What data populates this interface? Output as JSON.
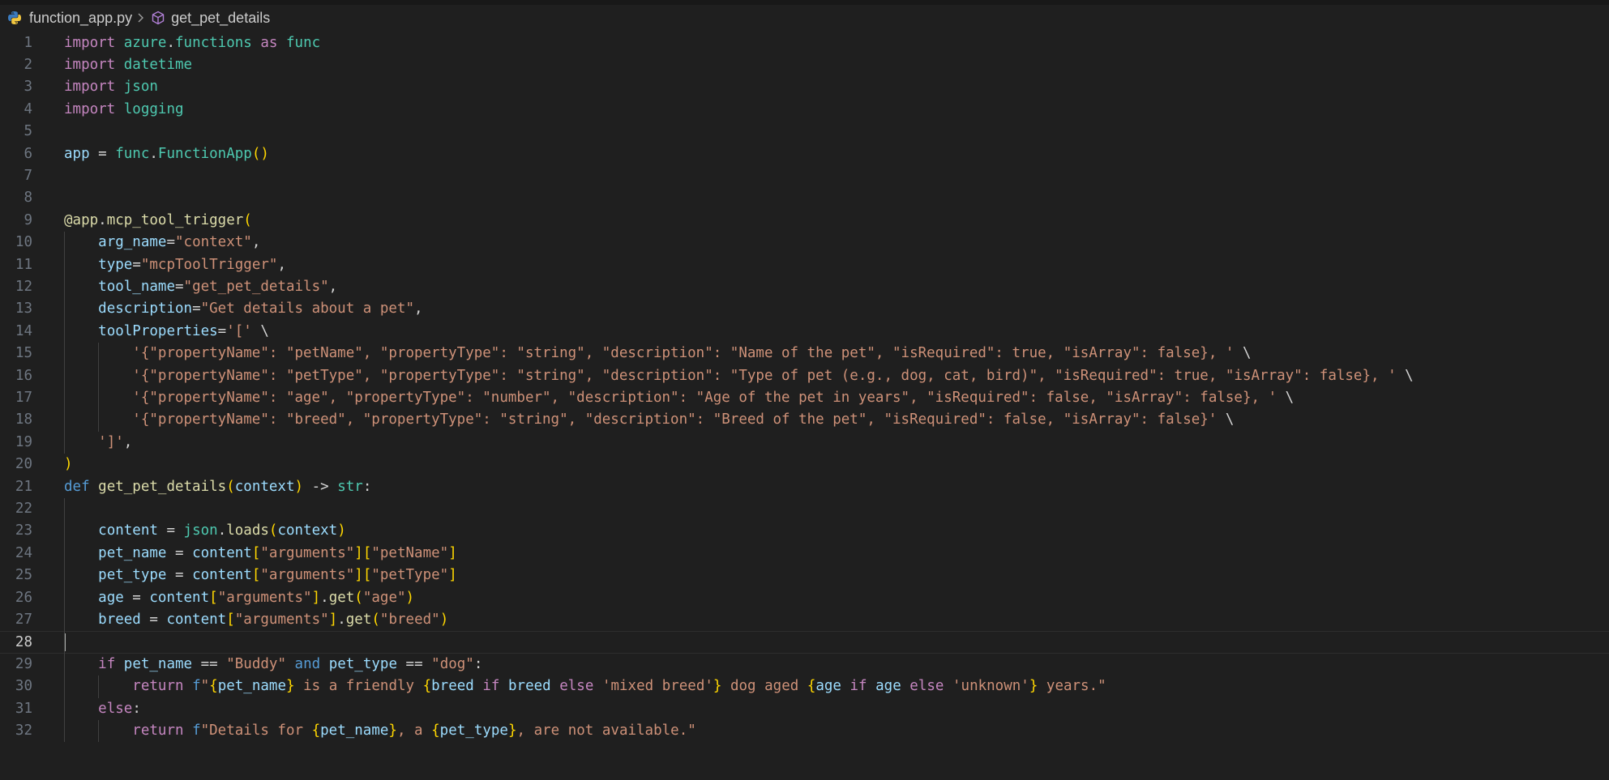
{
  "breadcrumb": {
    "file": "function_app.py",
    "symbol": "get_pet_details",
    "file_icon": "python-icon",
    "symbol_icon": "method-cube-icon"
  },
  "editor": {
    "language": "python",
    "active_line": 28,
    "colors": {
      "background": "#1f1f1f",
      "keyword": "#c586c0",
      "storage": "#569cd6",
      "module": "#4ec9b0",
      "function": "#dcdcaa",
      "variable": "#9cdcfe",
      "string": "#ce9178",
      "bracket": "#ffd700",
      "bracket2": "#da70d6",
      "operator": "#d4d4d4",
      "line_number": "#6e7681"
    },
    "lines": [
      {
        "n": "1",
        "tokens": [
          {
            "t": "import",
            "c": "k"
          },
          {
            "t": " ",
            "c": "p"
          },
          {
            "t": "azure",
            "c": "m"
          },
          {
            "t": ".",
            "c": "p"
          },
          {
            "t": "functions",
            "c": "m"
          },
          {
            "t": " ",
            "c": "p"
          },
          {
            "t": "as",
            "c": "k"
          },
          {
            "t": " ",
            "c": "p"
          },
          {
            "t": "func",
            "c": "m"
          }
        ]
      },
      {
        "n": "2",
        "tokens": [
          {
            "t": "import",
            "c": "k"
          },
          {
            "t": " ",
            "c": "p"
          },
          {
            "t": "datetime",
            "c": "md"
          }
        ]
      },
      {
        "n": "3",
        "tokens": [
          {
            "t": "import",
            "c": "k"
          },
          {
            "t": " ",
            "c": "p"
          },
          {
            "t": "json",
            "c": "m"
          }
        ]
      },
      {
        "n": "4",
        "tokens": [
          {
            "t": "import",
            "c": "k"
          },
          {
            "t": " ",
            "c": "p"
          },
          {
            "t": "logging",
            "c": "md"
          }
        ]
      },
      {
        "n": "5",
        "tokens": []
      },
      {
        "n": "6",
        "tokens": [
          {
            "t": "app",
            "c": "v"
          },
          {
            "t": " = ",
            "c": "p"
          },
          {
            "t": "func",
            "c": "m"
          },
          {
            "t": ".",
            "c": "p"
          },
          {
            "t": "FunctionApp",
            "c": "m"
          },
          {
            "t": "()",
            "c": "b1"
          }
        ]
      },
      {
        "n": "7",
        "tokens": []
      },
      {
        "n": "8",
        "tokens": []
      },
      {
        "n": "9",
        "tokens": [
          {
            "t": "@app",
            "c": "f"
          },
          {
            "t": ".",
            "c": "p"
          },
          {
            "t": "mcp_tool_trigger",
            "c": "f"
          },
          {
            "t": "(",
            "c": "b1"
          }
        ]
      },
      {
        "n": "10",
        "tokens": [
          {
            "t": "    ",
            "c": "p"
          },
          {
            "t": "arg_name",
            "c": "v"
          },
          {
            "t": "=",
            "c": "p"
          },
          {
            "t": "\"context\"",
            "c": "s"
          },
          {
            "t": ",",
            "c": "p"
          }
        ]
      },
      {
        "n": "11",
        "tokens": [
          {
            "t": "    ",
            "c": "p"
          },
          {
            "t": "type",
            "c": "v"
          },
          {
            "t": "=",
            "c": "p"
          },
          {
            "t": "\"mcpToolTrigger\"",
            "c": "s"
          },
          {
            "t": ",",
            "c": "p"
          }
        ]
      },
      {
        "n": "12",
        "tokens": [
          {
            "t": "    ",
            "c": "p"
          },
          {
            "t": "tool_name",
            "c": "v"
          },
          {
            "t": "=",
            "c": "p"
          },
          {
            "t": "\"get_pet_details\"",
            "c": "s"
          },
          {
            "t": ",",
            "c": "p"
          }
        ]
      },
      {
        "n": "13",
        "tokens": [
          {
            "t": "    ",
            "c": "p"
          },
          {
            "t": "description",
            "c": "v"
          },
          {
            "t": "=",
            "c": "p"
          },
          {
            "t": "\"Get details about a pet\"",
            "c": "s"
          },
          {
            "t": ",",
            "c": "p"
          }
        ]
      },
      {
        "n": "14",
        "tokens": [
          {
            "t": "    ",
            "c": "p"
          },
          {
            "t": "toolProperties",
            "c": "v"
          },
          {
            "t": "=",
            "c": "p"
          },
          {
            "t": "'['",
            "c": "s"
          },
          {
            "t": " \\",
            "c": "p"
          }
        ]
      },
      {
        "n": "15",
        "tokens": [
          {
            "t": "        ",
            "c": "p"
          },
          {
            "t": "'{\"propertyName\": \"petName\", \"propertyType\": \"string\", \"description\": \"Name of the pet\", \"isRequired\": true, \"isArray\": false}, '",
            "c": "s"
          },
          {
            "t": " \\",
            "c": "p"
          }
        ]
      },
      {
        "n": "16",
        "tokens": [
          {
            "t": "        ",
            "c": "p"
          },
          {
            "t": "'{\"propertyName\": \"petType\", \"propertyType\": \"string\", \"description\": \"Type of pet (e.g., dog, cat, bird)\", \"isRequired\": true, \"isArray\": false}, '",
            "c": "s"
          },
          {
            "t": " \\",
            "c": "p"
          }
        ]
      },
      {
        "n": "17",
        "tokens": [
          {
            "t": "        ",
            "c": "p"
          },
          {
            "t": "'{\"propertyName\": \"age\", \"propertyType\": \"number\", \"description\": \"Age of the pet in years\", \"isRequired\": false, \"isArray\": false}, '",
            "c": "s"
          },
          {
            "t": " \\",
            "c": "p"
          }
        ]
      },
      {
        "n": "18",
        "tokens": [
          {
            "t": "        ",
            "c": "p"
          },
          {
            "t": "'{\"propertyName\": \"breed\", \"propertyType\": \"string\", \"description\": \"Breed of the pet\", \"isRequired\": false, \"isArray\": false}'",
            "c": "s"
          },
          {
            "t": " \\",
            "c": "p"
          }
        ]
      },
      {
        "n": "19",
        "tokens": [
          {
            "t": "    ",
            "c": "p"
          },
          {
            "t": "']'",
            "c": "s"
          },
          {
            "t": ",",
            "c": "p"
          }
        ]
      },
      {
        "n": "20",
        "tokens": [
          {
            "t": ")",
            "c": "b1"
          }
        ]
      },
      {
        "n": "21",
        "tokens": [
          {
            "t": "def",
            "c": "st"
          },
          {
            "t": " ",
            "c": "p"
          },
          {
            "t": "get_pet_details",
            "c": "f"
          },
          {
            "t": "(",
            "c": "b1"
          },
          {
            "t": "context",
            "c": "v"
          },
          {
            "t": ")",
            "c": "b1"
          },
          {
            "t": " -> ",
            "c": "p"
          },
          {
            "t": "str",
            "c": "m"
          },
          {
            "t": ":",
            "c": "p"
          }
        ]
      },
      {
        "n": "22",
        "tokens": []
      },
      {
        "n": "23",
        "tokens": [
          {
            "t": "    ",
            "c": "p"
          },
          {
            "t": "content",
            "c": "v"
          },
          {
            "t": " = ",
            "c": "p"
          },
          {
            "t": "json",
            "c": "m"
          },
          {
            "t": ".",
            "c": "p"
          },
          {
            "t": "loads",
            "c": "f"
          },
          {
            "t": "(",
            "c": "b1"
          },
          {
            "t": "context",
            "c": "v"
          },
          {
            "t": ")",
            "c": "b1"
          }
        ]
      },
      {
        "n": "24",
        "tokens": [
          {
            "t": "    ",
            "c": "p"
          },
          {
            "t": "pet_name",
            "c": "v"
          },
          {
            "t": " = ",
            "c": "p"
          },
          {
            "t": "content",
            "c": "v"
          },
          {
            "t": "[",
            "c": "b1"
          },
          {
            "t": "\"arguments\"",
            "c": "s"
          },
          {
            "t": "][",
            "c": "b1"
          },
          {
            "t": "\"petName\"",
            "c": "s"
          },
          {
            "t": "]",
            "c": "b1"
          }
        ]
      },
      {
        "n": "25",
        "tokens": [
          {
            "t": "    ",
            "c": "p"
          },
          {
            "t": "pet_type",
            "c": "v"
          },
          {
            "t": " = ",
            "c": "p"
          },
          {
            "t": "content",
            "c": "v"
          },
          {
            "t": "[",
            "c": "b1"
          },
          {
            "t": "\"arguments\"",
            "c": "s"
          },
          {
            "t": "][",
            "c": "b1"
          },
          {
            "t": "\"petType\"",
            "c": "s"
          },
          {
            "t": "]",
            "c": "b1"
          }
        ]
      },
      {
        "n": "26",
        "tokens": [
          {
            "t": "    ",
            "c": "p"
          },
          {
            "t": "age",
            "c": "v"
          },
          {
            "t": " = ",
            "c": "p"
          },
          {
            "t": "content",
            "c": "v"
          },
          {
            "t": "[",
            "c": "b1"
          },
          {
            "t": "\"arguments\"",
            "c": "s"
          },
          {
            "t": "]",
            "c": "b1"
          },
          {
            "t": ".",
            "c": "p"
          },
          {
            "t": "get",
            "c": "f"
          },
          {
            "t": "(",
            "c": "b1"
          },
          {
            "t": "\"age\"",
            "c": "s"
          },
          {
            "t": ")",
            "c": "b1"
          }
        ]
      },
      {
        "n": "27",
        "tokens": [
          {
            "t": "    ",
            "c": "p"
          },
          {
            "t": "breed",
            "c": "v"
          },
          {
            "t": " = ",
            "c": "p"
          },
          {
            "t": "content",
            "c": "v"
          },
          {
            "t": "[",
            "c": "b1"
          },
          {
            "t": "\"arguments\"",
            "c": "s"
          },
          {
            "t": "]",
            "c": "b1"
          },
          {
            "t": ".",
            "c": "p"
          },
          {
            "t": "get",
            "c": "f"
          },
          {
            "t": "(",
            "c": "b1"
          },
          {
            "t": "\"breed\"",
            "c": "s"
          },
          {
            "t": ")",
            "c": "b1"
          }
        ]
      },
      {
        "n": "28",
        "tokens": []
      },
      {
        "n": "29",
        "tokens": [
          {
            "t": "    ",
            "c": "p"
          },
          {
            "t": "if",
            "c": "k"
          },
          {
            "t": " ",
            "c": "p"
          },
          {
            "t": "pet_name",
            "c": "v"
          },
          {
            "t": " == ",
            "c": "p"
          },
          {
            "t": "\"Buddy\"",
            "c": "s"
          },
          {
            "t": " ",
            "c": "p"
          },
          {
            "t": "and",
            "c": "st"
          },
          {
            "t": " ",
            "c": "p"
          },
          {
            "t": "pet_type",
            "c": "v"
          },
          {
            "t": " == ",
            "c": "p"
          },
          {
            "t": "\"dog\"",
            "c": "s"
          },
          {
            "t": ":",
            "c": "p"
          }
        ]
      },
      {
        "n": "30",
        "tokens": [
          {
            "t": "        ",
            "c": "p"
          },
          {
            "t": "return",
            "c": "k"
          },
          {
            "t": " ",
            "c": "p"
          },
          {
            "t": "f",
            "c": "st"
          },
          {
            "t": "\"",
            "c": "s"
          },
          {
            "t": "{",
            "c": "b1"
          },
          {
            "t": "pet_name",
            "c": "v"
          },
          {
            "t": "}",
            "c": "b1"
          },
          {
            "t": " is a friendly ",
            "c": "s"
          },
          {
            "t": "{",
            "c": "b1"
          },
          {
            "t": "breed",
            "c": "v"
          },
          {
            "t": " ",
            "c": "p"
          },
          {
            "t": "if",
            "c": "k"
          },
          {
            "t": " ",
            "c": "p"
          },
          {
            "t": "breed",
            "c": "v"
          },
          {
            "t": " ",
            "c": "p"
          },
          {
            "t": "else",
            "c": "k"
          },
          {
            "t": " ",
            "c": "p"
          },
          {
            "t": "'mixed breed'",
            "c": "s"
          },
          {
            "t": "}",
            "c": "b1"
          },
          {
            "t": " dog aged ",
            "c": "s"
          },
          {
            "t": "{",
            "c": "b1"
          },
          {
            "t": "age",
            "c": "v"
          },
          {
            "t": " ",
            "c": "p"
          },
          {
            "t": "if",
            "c": "k"
          },
          {
            "t": " ",
            "c": "p"
          },
          {
            "t": "age",
            "c": "v"
          },
          {
            "t": " ",
            "c": "p"
          },
          {
            "t": "else",
            "c": "k"
          },
          {
            "t": " ",
            "c": "p"
          },
          {
            "t": "'unknown'",
            "c": "s"
          },
          {
            "t": "}",
            "c": "b1"
          },
          {
            "t": " years.\"",
            "c": "s"
          }
        ]
      },
      {
        "n": "31",
        "tokens": [
          {
            "t": "    ",
            "c": "p"
          },
          {
            "t": "else",
            "c": "k"
          },
          {
            "t": ":",
            "c": "p"
          }
        ]
      },
      {
        "n": "32",
        "tokens": [
          {
            "t": "        ",
            "c": "p"
          },
          {
            "t": "return",
            "c": "k"
          },
          {
            "t": " ",
            "c": "p"
          },
          {
            "t": "f",
            "c": "st"
          },
          {
            "t": "\"Details for ",
            "c": "s"
          },
          {
            "t": "{",
            "c": "b1"
          },
          {
            "t": "pet_name",
            "c": "v"
          },
          {
            "t": "}",
            "c": "b1"
          },
          {
            "t": ", a ",
            "c": "s"
          },
          {
            "t": "{",
            "c": "b1"
          },
          {
            "t": "pet_type",
            "c": "v"
          },
          {
            "t": "}",
            "c": "b1"
          },
          {
            "t": ", are not available.\"",
            "c": "s"
          }
        ]
      }
    ]
  }
}
